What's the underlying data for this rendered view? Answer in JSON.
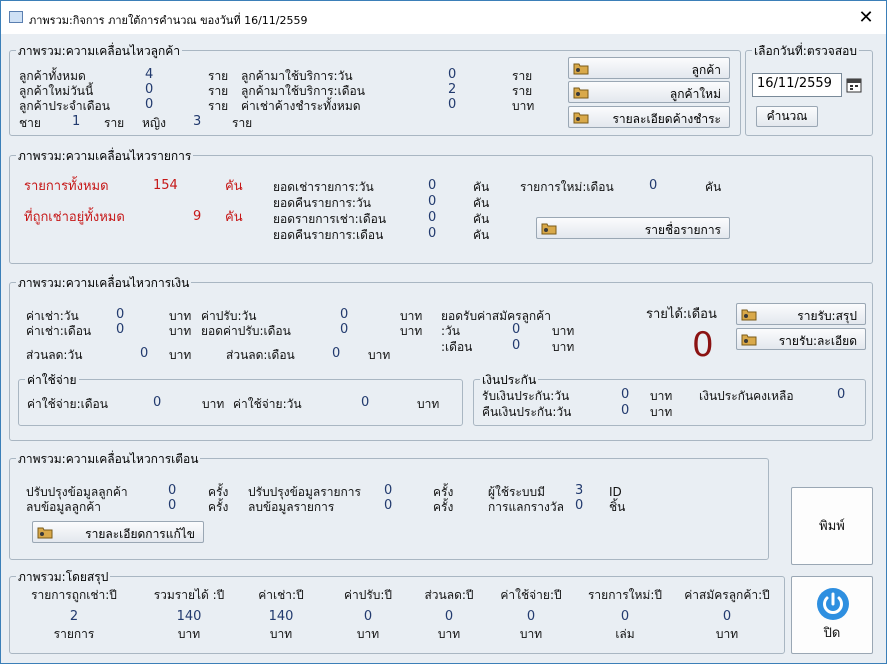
{
  "window": {
    "title": "ภาพรวม:กิจการ ภายใต้การคำนวณ ของวันที่  16/11/2559",
    "close": "✕"
  },
  "customer": {
    "title": "ภาพรวม:ความเคลื่อนไหวลูกค้า",
    "total_label": "ลูกค้าทั้งหมด",
    "total": "4",
    "new_today_label": "ลูกค้าใหม่วันนี้",
    "new_today": "0",
    "monthly_label": "ลูกค้าประจำเดือน",
    "monthly": "0",
    "male_label": "ชาย",
    "male": "1",
    "female_label": "หญิง",
    "female": "3",
    "unit_person": "ราย",
    "unit_baht": "บาท",
    "svc_day_label": "ลูกค้ามาใช้บริการ:วัน",
    "svc_day": "0",
    "svc_month_label": "ลูกค้ามาใช้บริการ:เดือน",
    "svc_month": "2",
    "rent_due_label": "ค่าเช่าค้างชำระทั้งหมด",
    "rent_due": "0",
    "btn_customer": "ลูกค้า",
    "btn_new_customer": "ลูกค้าใหม่",
    "btn_due_detail": "รายละเอียดค้างชำระ"
  },
  "date_sel": {
    "title": "เลือกวันที่:ตรวจสอบ",
    "value": "16/11/2559",
    "calc": "คำนวณ"
  },
  "items": {
    "title": "ภาพรวม:ความเคลื่อนไหวรายการ",
    "all_label": "รายการทั้งหมด",
    "all": "154",
    "unit": "คัน",
    "rented_label": "ที่ถูกเช่าอยู่ทั้งหมด",
    "rented": "9",
    "rent_day_label": "ยอดเช่ารายการ:วัน",
    "rent_day": "0",
    "return_day_label": "ยอดคืนรายการ:วัน",
    "return_day": "0",
    "rent_month_label": "ยอดรายการเช่า:เดือน",
    "rent_month": "0",
    "return_month_label": "ยอดคืนรายการ:เดือน",
    "return_month": "0",
    "new_month_label": "รายการใหม่:เดือน",
    "new_month": "0",
    "btn_list": "รายชื่อรายการ"
  },
  "money": {
    "title": "ภาพรวม:ความเคลื่อนไหวการเงิน",
    "rent_day_label": "ค่าเช่า:วัน",
    "rent_day": "0",
    "rent_month_label": "ค่าเช่า:เดือน",
    "rent_month": "0",
    "discount_day_label": "ส่วนลด:วัน",
    "discount_day": "0",
    "fine_day_label": "ค่าปรับ:วัน",
    "fine_day": "0",
    "fine_month_label": "ยอดค่าปรับ:เดือน",
    "fine_month": "0",
    "discount_month_label": "ส่วนลด:เดือน",
    "discount_month": "0",
    "baht": "บาท",
    "fee_label": "ยอดรับค่าสมัครลูกค้า",
    "fee_day_label": ":วัน",
    "fee_day": "0",
    "fee_month_label": ":เดือน",
    "fee_month": "0",
    "income_label": "รายได้:เดือน",
    "income": "0",
    "btn_income_summary": "รายรับ:สรุป",
    "btn_income_detail": "รายรับ:ละเอียด",
    "expense": {
      "title": "ค่าใช้จ่าย",
      "month_label": "ค่าใช้จ่าย:เดือน",
      "month": "0",
      "day_label": "ค่าใช้จ่าย:วัน",
      "day": "0"
    },
    "deposit": {
      "title": "เงินประกัน",
      "recv_label": "รับเงินประกัน:วัน",
      "recv": "0",
      "ret_label": "คืนเงินประกัน:วัน",
      "ret": "0",
      "remain_label": "เงินประกันคงเหลือ",
      "remain": "0"
    }
  },
  "alerts": {
    "title": "ภาพรวม:ความเคลื่อนไหวการเตือน",
    "upd_cust_label": "ปรับปรุงข้อมูลลูกค้า",
    "upd_cust": "0",
    "del_cust_label": "ลบข้อมูลลูกค้า",
    "del_cust": "0",
    "upd_item_label": "ปรับปรุงข้อมูลรายการ",
    "upd_item": "0",
    "del_item_label": "ลบข้อมูลรายการ",
    "del_item": "0",
    "times": "ครั้ง",
    "users_label": "ผู้ใช้ระบบมี",
    "users": "3",
    "users_unit": "ID",
    "prize_label": "การแลกรางวัล",
    "prize": "0",
    "prize_unit": "ชิ้น",
    "btn_edit_detail": "รายละเอียดการแก้ไข"
  },
  "summary": {
    "title": "ภาพรวม:โดยสรุป",
    "cols": [
      {
        "h": "รายการถูกเช่า:ปี",
        "v": "2",
        "u": "รายการ"
      },
      {
        "h": "รวมรายได้ :ปี",
        "v": "140",
        "u": "บาท"
      },
      {
        "h": "ค่าเช่า:ปี",
        "v": "140",
        "u": "บาท"
      },
      {
        "h": "ค่าปรับ:ปี",
        "v": "0",
        "u": "บาท"
      },
      {
        "h": "ส่วนลด:ปี",
        "v": "0",
        "u": "บาท"
      },
      {
        "h": "ค่าใช้จ่าย:ปี",
        "v": "0",
        "u": "บาท"
      },
      {
        "h": "รายการใหม่:ปี",
        "v": "0",
        "u": "เล่ม"
      },
      {
        "h": "ค่าสมัครลูกค้า:ปี",
        "v": "0",
        "u": "บาท"
      }
    ]
  },
  "actions": {
    "print": "พิมพ์",
    "close": "ปิด"
  },
  "colors": {
    "red": "#c61818",
    "accent": "#1f77c8"
  }
}
